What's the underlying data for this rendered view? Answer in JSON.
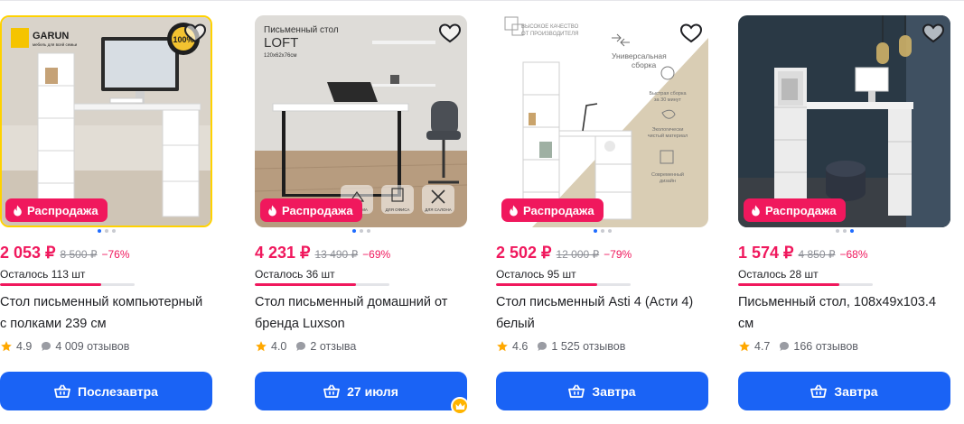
{
  "colors": {
    "accent": "#1a63f5",
    "sale": "#f0185d",
    "muted": "#8d8f96",
    "star": "#ffa800"
  },
  "icons": {
    "favorite": "heart-outline-icon",
    "sale": "flame-icon",
    "delivery": "basket-icon",
    "rating": "star-icon",
    "reviews": "comment-bubble-icon",
    "badge": "crown-icon"
  },
  "products": [
    {
      "image_text": {
        "line1": "Письменный стол",
        "line2": "LOFT",
        "line3": "120х62х76см",
        "f1": "ДЛЯ ДОМА",
        "f2": "ДЛЯ ОФИСА",
        "f3": "ДЛЯ САЛОНА"
      },
      "sale_label": "Распродажа",
      "price": "4 231 ₽",
      "old_price": "13 490 ₽",
      "discount": "−69%",
      "stock_text": "Осталось 36 шт",
      "stock_level": 0.75,
      "title": "Стол письменный домашний от бренда Luxson",
      "rating": "4.0",
      "reviews": "2 отзыва",
      "delivery": "27 июля",
      "carousel": {
        "count": 3,
        "active": 0
      }
    },
    {
      "image_text": {
        "q1": "ВЫСОКОЕ КАЧЕСТВО",
        "q2": "ОТ ПРОИЗВОДИТЕЛЯ",
        "u1": "Универсальная",
        "u2": "сборка",
        "s1": "Быстрая сборка",
        "s2": "за 30 минут",
        "e1": "Экологически",
        "e2": "чистый материал",
        "d1": "Современный",
        "d2": "дизайн"
      },
      "sale_label": "Распродажа",
      "price": "2 502 ₽",
      "old_price": "12 000 ₽",
      "discount": "−79%",
      "stock_text": "Осталось 95 шт",
      "stock_level": 0.75,
      "title": "Стол письменный Asti 4 (Асти 4) белый",
      "rating": "4.6",
      "reviews": "1 525 отзывов",
      "delivery": "Завтра",
      "carousel": {
        "count": 3,
        "active": 0
      }
    },
    {
      "image_text": {},
      "sale_label": "Распродажа",
      "price": "1 574 ₽",
      "old_price": "4 850 ₽",
      "discount": "−68%",
      "stock_text": "Осталось 28 шт",
      "stock_level": 0.75,
      "title": "Письменный стол, 108х49х103.4 см",
      "rating": "4.7",
      "reviews": "166 отзывов",
      "delivery": "Завтра",
      "carousel": {
        "count": 3,
        "active": 2
      }
    },
    {
      "image_text": {
        "brand": "GARUN",
        "brand_sub": "мебель для всей семьи",
        "seal": "100%"
      },
      "sale_label": "Распродажа",
      "price": "2 053 ₽",
      "old_price": "8 500 ₽",
      "discount": "−76%",
      "stock_text": "Осталось 113 шт",
      "stock_level": 0.75,
      "title": "Стол письменный компьютерный с полками 239 см",
      "rating": "4.9",
      "reviews": "4 009 отзывов",
      "delivery": "Послезавтра",
      "carousel": {
        "count": 3,
        "active": 0
      }
    }
  ]
}
